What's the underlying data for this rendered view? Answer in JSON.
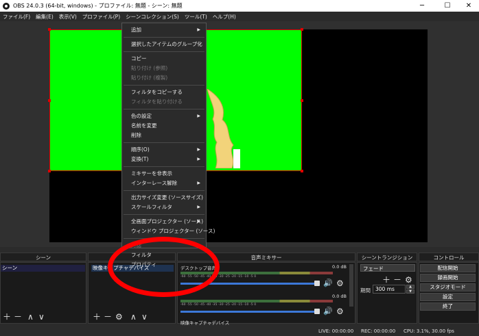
{
  "window": {
    "title": "OBS 24.0.3 (64-bit, windows) - プロファイル: 無題 - シーン: 無題",
    "minimize": "─",
    "maximize": "☐",
    "close": "✕"
  },
  "menubar": [
    "ファイル(F)",
    "編集(E)",
    "表示(V)",
    "プロファイル(P)",
    "シーンコレクション(S)",
    "ツール(T)",
    "ヘルプ(H)"
  ],
  "context_menu": {
    "items": [
      {
        "label": "追加",
        "submenu": true
      },
      {
        "sep": true
      },
      {
        "label": "選択したアイテムのグループ化"
      },
      {
        "sep": true
      },
      {
        "label": "コピー"
      },
      {
        "label": "貼り付け (参照)",
        "disabled": true
      },
      {
        "label": "貼り付け (複製)",
        "disabled": true
      },
      {
        "sep": true
      },
      {
        "label": "フィルタをコピーする"
      },
      {
        "label": "フィルタを貼り付ける",
        "disabled": true
      },
      {
        "sep": true
      },
      {
        "label": "色の設定",
        "submenu": true
      },
      {
        "label": "名前を変更"
      },
      {
        "label": "削除"
      },
      {
        "sep": true
      },
      {
        "label": "順序(O)",
        "submenu": true
      },
      {
        "label": "変換(T)",
        "submenu": true
      },
      {
        "sep": true
      },
      {
        "label": "ミキサーを非表示"
      },
      {
        "label": "インターレース解除",
        "submenu": true
      },
      {
        "sep": true
      },
      {
        "label": "出力サイズ変更 (ソースサイズ)"
      },
      {
        "label": "スケールフィルタ",
        "submenu": true
      },
      {
        "sep": true
      },
      {
        "label": "全画面プロジェクター (ソース)",
        "submenu": true
      },
      {
        "label": "ウィンドウ プロジェクター (ソース)"
      },
      {
        "sep": true
      },
      {
        "label": "対話",
        "disabled": true
      },
      {
        "label": "フィルタ"
      },
      {
        "label": "プロパティ"
      }
    ]
  },
  "docks": {
    "scenes": {
      "title": "シーン",
      "item": "シーン"
    },
    "sources": {
      "item": "映像キャプチャデバイス"
    },
    "mixer": {
      "title": "音声ミキサー",
      "track1": {
        "name": "デスクトップ音声",
        "db": "0.0 dB"
      },
      "track2": {
        "db": "0.0 dB"
      },
      "track3": {
        "name": "映像キャプチャデバイス"
      },
      "scale": "-60 -55 -50 -45 -40 -35 -30 -25 -20 -15 -10 -5 0"
    },
    "transitions": {
      "title": "シーントランジション",
      "selected": "フェード",
      "duration_label": "期間",
      "duration_value": "300 ms"
    },
    "controls": {
      "title": "コントロール",
      "buttons": [
        "配信開始",
        "録画開始",
        "スタジオモード",
        "設定",
        "終了"
      ]
    }
  },
  "statusbar": {
    "live": "LIVE: 00:00:00",
    "rec": "REC: 00:00:00",
    "cpu": "CPU: 3.1%, 30.00 fps"
  },
  "colors": {
    "green_source": "#00ff00",
    "selection_red": "#e00000",
    "annotation_red": "#ff0000",
    "panel_bg": "#2b2b2b"
  }
}
